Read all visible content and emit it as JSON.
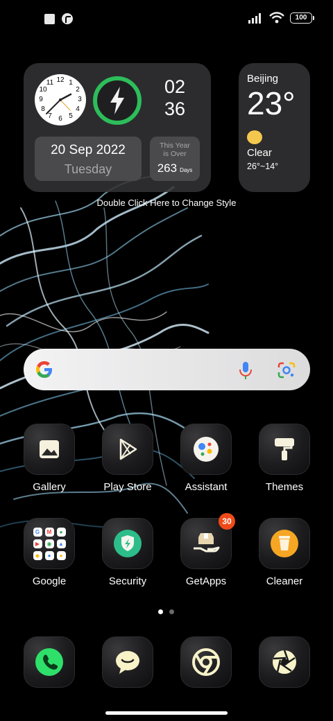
{
  "status_bar": {
    "battery": "100"
  },
  "clock_widget": {
    "hour": "02",
    "minute": "36",
    "date": "20 Sep 2022",
    "weekday": "Tuesday",
    "year_label_line1": "This Year",
    "year_label_line2": "is Over",
    "days_count": "263",
    "days_unit": "Days",
    "clock_numbers": [
      "12",
      "1",
      "2",
      "3",
      "4",
      "5",
      "6",
      "7",
      "8",
      "9",
      "10",
      "11"
    ]
  },
  "weather_widget": {
    "city": "Beijing",
    "temperature": "23°",
    "condition": "Clear",
    "range": "26°~14°",
    "icon": "sun-icon"
  },
  "style_hint": "Double Click Here to Change Style",
  "search": {
    "logo": "google-g-icon",
    "mic_icon": "mic-icon",
    "lens_icon": "lens-icon"
  },
  "apps": {
    "row1": [
      {
        "label": "Gallery",
        "icon": "gallery-icon"
      },
      {
        "label": "Play Store",
        "icon": "play-store-icon"
      },
      {
        "label": "Assistant",
        "icon": "assistant-icon"
      },
      {
        "label": "Themes",
        "icon": "themes-icon"
      }
    ],
    "row2": [
      {
        "label": "Google",
        "icon": "google-folder-icon"
      },
      {
        "label": "Security",
        "icon": "security-icon"
      },
      {
        "label": "GetApps",
        "icon": "getapps-icon",
        "badge": "30"
      },
      {
        "label": "Cleaner",
        "icon": "cleaner-icon"
      }
    ],
    "folder_letters": [
      "G",
      "M",
      "",
      "",
      "",
      "",
      "",
      "",
      ""
    ]
  },
  "dock": [
    "phone-icon",
    "messages-icon",
    "chrome-icon",
    "camera-icon"
  ],
  "colors": {
    "accent_green": "#2dbd5a",
    "badge_red": "#f04a1a",
    "sun_yellow": "#f4c84e"
  }
}
